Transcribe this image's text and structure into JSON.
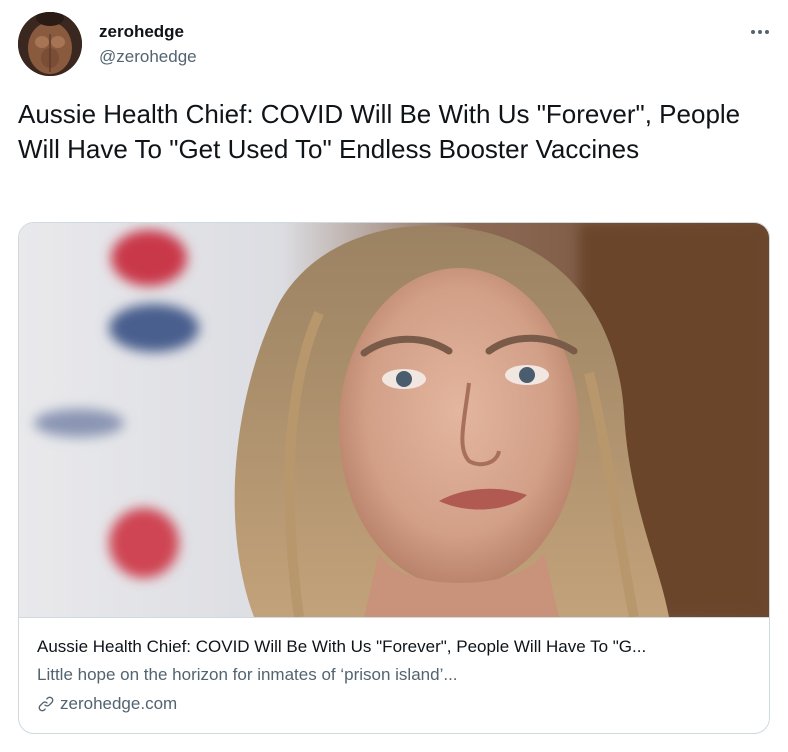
{
  "author": {
    "display_name": "zerohedge",
    "handle": "@zerohedge"
  },
  "tweet": {
    "text": "Aussie Health Chief: COVID Will Be With Us \"Forever\", People Will Have To \"Get Used To\" Endless Booster Vaccines"
  },
  "card": {
    "title": "Aussie Health Chief: COVID Will Be With Us \"Forever\", People Will Have To \"G...",
    "description": "Little hope on the horizon for inmates of ‘prison island’...",
    "domain": "zerohedge.com"
  },
  "icons": {
    "more": "more-horizontal-icon",
    "link": "link-icon"
  },
  "colors": {
    "text_primary": "#0f1419",
    "text_secondary": "#536471",
    "border": "#cfd9de"
  }
}
